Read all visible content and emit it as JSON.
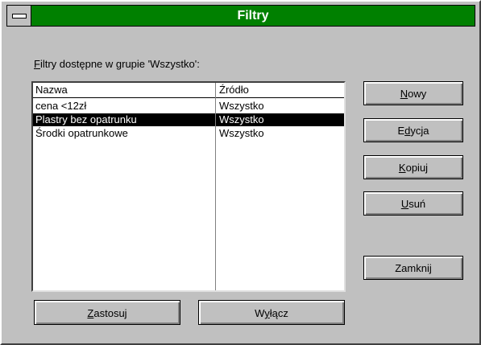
{
  "window": {
    "title": "Filtry"
  },
  "group_label": {
    "mnemonic": "F",
    "rest": "iltry dostępne w grupie 'Wszystko':"
  },
  "list": {
    "columns": [
      "Nazwa",
      "Źródło"
    ],
    "rows": [
      {
        "name": "cena <12zł",
        "source": "Wszystko",
        "selected": false
      },
      {
        "name": "Plastry bez opatrunku",
        "source": "Wszystko",
        "selected": true
      },
      {
        "name": "Środki opatrunkowe",
        "source": "Wszystko",
        "selected": false
      }
    ]
  },
  "buttons": {
    "new": {
      "mnemonic": "N",
      "rest": "owy"
    },
    "edit": {
      "pre": "E",
      "mnemonic": "d",
      "rest": "ycja"
    },
    "copy": {
      "mnemonic": "K",
      "rest": "opiuj"
    },
    "delete": {
      "mnemonic": "U",
      "rest": "suń"
    },
    "close": {
      "label": "Zamknij"
    },
    "apply": {
      "mnemonic": "Z",
      "rest": "astosuj"
    },
    "disable": {
      "pre": "W",
      "mnemonic": "y",
      "rest": "łącz"
    }
  }
}
